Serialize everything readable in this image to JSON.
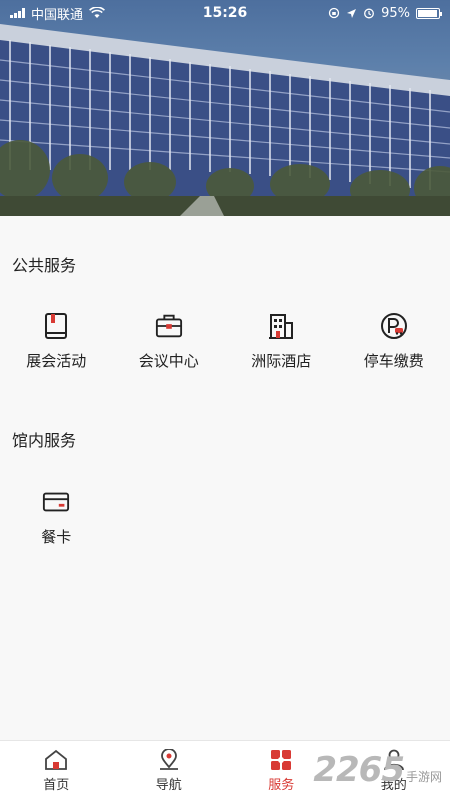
{
  "status_bar": {
    "carrier": "中国联通",
    "time": "15:26",
    "battery": "95%",
    "battery_level": 0.95
  },
  "public_services": {
    "title": "公共服务",
    "items": [
      {
        "label": "展会活动",
        "icon": "exhibition-book-icon"
      },
      {
        "label": "会议中心",
        "icon": "briefcase-icon"
      },
      {
        "label": "洲际酒店",
        "icon": "hotel-building-icon"
      },
      {
        "label": "停车缴费",
        "icon": "parking-icon"
      }
    ]
  },
  "venue_services": {
    "title": "馆内服务",
    "items": [
      {
        "label": "餐卡",
        "icon": "meal-card-icon"
      }
    ]
  },
  "tabbar": {
    "items": [
      {
        "label": "首页",
        "icon": "home-icon"
      },
      {
        "label": "导航",
        "icon": "navigation-pin-icon"
      },
      {
        "label": "服务",
        "icon": "service-grid-icon",
        "active": true
      },
      {
        "label": "我的",
        "icon": "user-icon"
      }
    ],
    "active_color": "#d83a34"
  },
  "watermark": {
    "brand": "2265",
    "site": "手游网"
  }
}
